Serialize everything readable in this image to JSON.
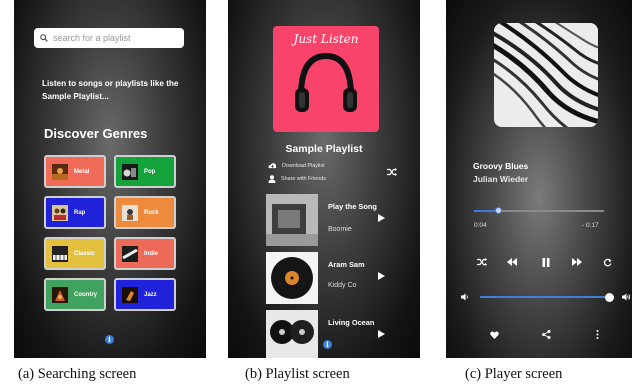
{
  "searching": {
    "placeholder": "search for a playlist",
    "intro": "Listen to songs or playlists like the Sample Playlist...",
    "genres_title": "Discover Genres",
    "genres": [
      {
        "label": "Metal",
        "color": "#f06b58"
      },
      {
        "label": "Pop",
        "color": "#13a33a"
      },
      {
        "label": "Rap",
        "color": "#1f22d9"
      },
      {
        "label": "Rock",
        "color": "#ee8a3c"
      },
      {
        "label": "Classic",
        "color": "#e3c13f"
      },
      {
        "label": "Indie",
        "color": "#ee6a58"
      },
      {
        "label": "Country",
        "color": "#3fa35f"
      },
      {
        "label": "Jazz",
        "color": "#1f22d9"
      }
    ],
    "caption": "(a) Searching screen"
  },
  "playlist": {
    "cover_title": "Just Listen",
    "cover_color": "#f8436a",
    "title": "Sample Playlist",
    "download_label": "Download Playlist",
    "share_label": "Share with Friends",
    "tracks": [
      {
        "title": "Play the Song",
        "artist": "Boomie"
      },
      {
        "title": "Aram Sam",
        "artist": "Kiddy Co"
      },
      {
        "title": "Living Ocean",
        "artist": ""
      }
    ],
    "caption": "(b) Playlist screen"
  },
  "player": {
    "song_title": "Groovy Blues",
    "artist": "Julian Wieder",
    "elapsed": "0:04",
    "remaining": "- 0:17",
    "progress": 0.19,
    "volume": 0.95,
    "accent": "#3d7fd6",
    "caption": "(c) Player screen"
  }
}
